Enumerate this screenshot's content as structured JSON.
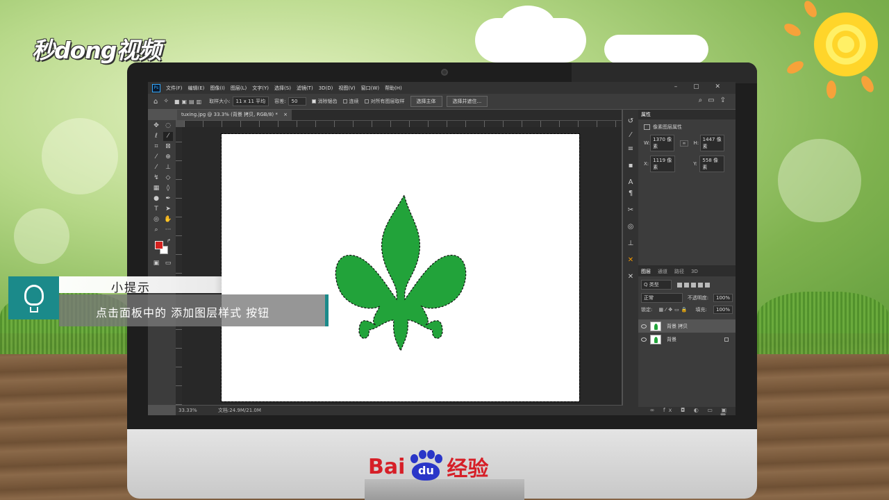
{
  "logos": {
    "miaodong": "秒dong视频",
    "baidu_prefix": "Bai",
    "baidu_paw": "du",
    "baidu_suffix": "经验"
  },
  "app": {
    "menu": [
      "文件(F)",
      "编辑(E)",
      "图像(I)",
      "图层(L)",
      "文字(Y)",
      "选择(S)",
      "滤镜(T)",
      "3D(D)",
      "视图(V)",
      "窗口(W)",
      "帮助(H)"
    ],
    "window_controls": "– ▢ ✕",
    "ps_logo": "Ps"
  },
  "options": {
    "sample_size_label": "取样大小:",
    "sample_size_value": "11 x 11 平均",
    "tolerance_label": "容差:",
    "tolerance_value": "50",
    "antialias_label": "消除锯齿",
    "contiguous_label": "连续",
    "sample_all_label": "对所有图层取样",
    "select_subject": "选择主体",
    "select_mask": "选择并遮住..."
  },
  "document": {
    "tab_title": "tuxing.jpg @ 33.3% (背景 拷贝, RGB/8) *",
    "tab_close": "×"
  },
  "status": {
    "zoom": "33.33%",
    "doc_size": "文档:24.9M/21.0M"
  },
  "properties": {
    "tab": "属性",
    "title": "像素图层属性",
    "w_label": "W:",
    "w_value": "1370 像素",
    "h_label": "H:",
    "h_value": "1447 像素",
    "x_label": "X:",
    "x_value": "1119 像素",
    "y_label": "Y:",
    "y_value": "558 像素",
    "link_icon": "∞"
  },
  "layers": {
    "tabs": [
      "图层",
      "通道",
      "路径",
      "3D"
    ],
    "filter_label": "Q 类型",
    "blend_mode": "正常",
    "opacity_label": "不透明度:",
    "opacity_value": "100%",
    "lock_label": "锁定:",
    "fill_label": "填充:",
    "fill_value": "100%",
    "rows": [
      {
        "name": "背景 拷贝",
        "selected": true,
        "locked": false
      },
      {
        "name": "背景",
        "selected": false,
        "locked": true
      }
    ],
    "footer_icons": "∞ fx ◘ ◐ ▭ ▣ 🗑"
  },
  "tip": {
    "title": "小提示",
    "text": "点击面板中的 添加图层样式 按钮"
  },
  "colors": {
    "shape_green": "#22a33a",
    "foreground": "#d6221f",
    "background": "#ffffff",
    "tip_accent": "#1b8a8a"
  }
}
